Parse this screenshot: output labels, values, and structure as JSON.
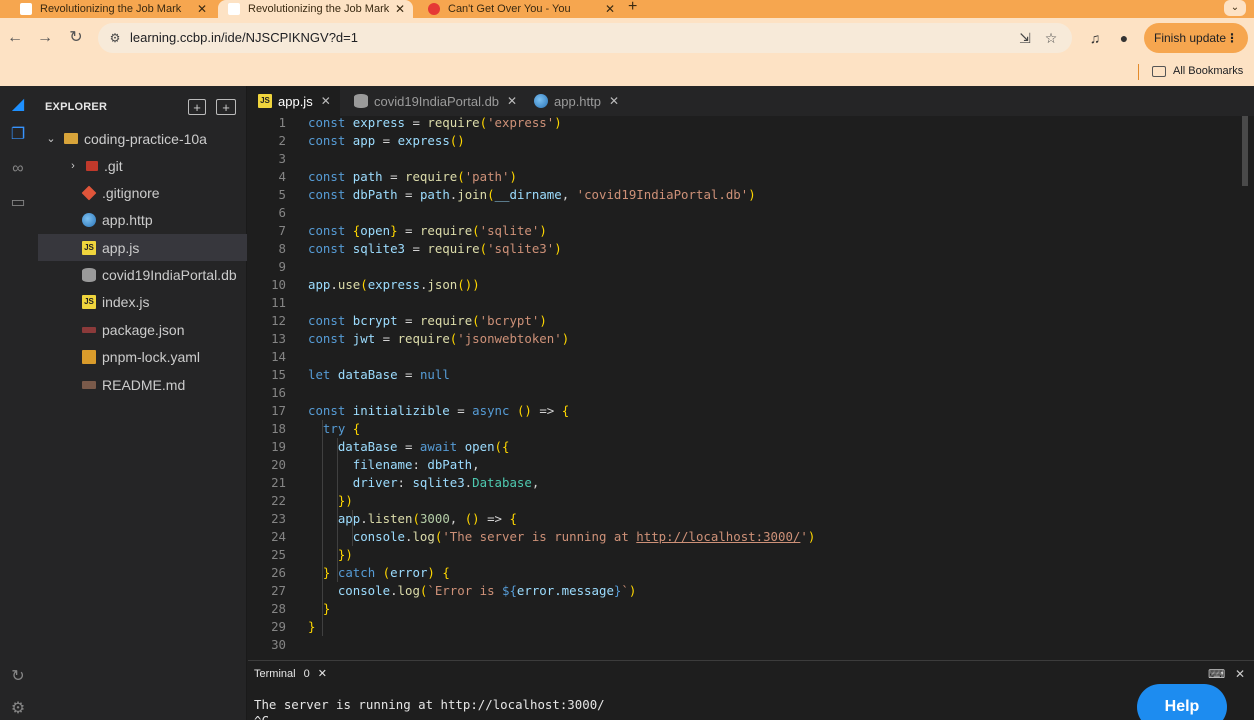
{
  "browser": {
    "tabs": [
      {
        "title": "Revolutionizing the Job Mark"
      },
      {
        "title": "Revolutionizing the Job Mark"
      },
      {
        "title": "Can't Get Over You - You"
      }
    ],
    "url": "learning.ccbp.in/ide/NJSCPIKNGV?d=1",
    "finish_update": "Finish update",
    "bookmarks_label": "All Bookmarks",
    "accent": "#f6a64f"
  },
  "explorer": {
    "title": "EXPLORER",
    "root": "coding-practice-10a",
    "items": [
      {
        "label": ".git",
        "icon": "folder-git-icon"
      },
      {
        "label": ".gitignore",
        "icon": "git-icon"
      },
      {
        "label": "app.http",
        "icon": "globe-icon"
      },
      {
        "label": "app.js",
        "icon": "js-icon"
      },
      {
        "label": "covid19IndiaPortal.db",
        "icon": "database-icon"
      },
      {
        "label": "index.js",
        "icon": "js-icon"
      },
      {
        "label": "package.json",
        "icon": "npm-icon"
      },
      {
        "label": "pnpm-lock.yaml",
        "icon": "yaml-icon"
      },
      {
        "label": "README.md",
        "icon": "markdown-icon"
      }
    ]
  },
  "editor": {
    "tabs": [
      {
        "label": "app.js"
      },
      {
        "label": "covid19IndiaPortal.db"
      },
      {
        "label": "app.http"
      }
    ],
    "code_lines": [
      "const express = require('express')",
      "const app = express()",
      "",
      "const path = require('path')",
      "const dbPath = path.join(__dirname, 'covid19IndiaPortal.db')",
      "",
      "const {open} = require('sqlite')",
      "const sqlite3 = require('sqlite3')",
      "",
      "app.use(express.json())",
      "",
      "const bcrypt = require('bcrypt')",
      "const jwt = require('jsonwebtoken')",
      "",
      "let dataBase = null",
      "",
      "const initializible = async () => {",
      "  try {",
      "    dataBase = await open({",
      "      filename: dbPath,",
      "      driver: sqlite3.Database,",
      "    })",
      "    app.listen(3000, () => {",
      "      console.log('The server is running at http://localhost:3000/')",
      "    })",
      "  } catch (error) {",
      "    console.log(`Error is ${error.message}`)",
      "  }",
      "}",
      ""
    ]
  },
  "terminal": {
    "tab_label": "Terminal",
    "count": "0",
    "lines": [
      "The server is running at http://localhost:3000/",
      "^C"
    ]
  },
  "help_label": "Help"
}
